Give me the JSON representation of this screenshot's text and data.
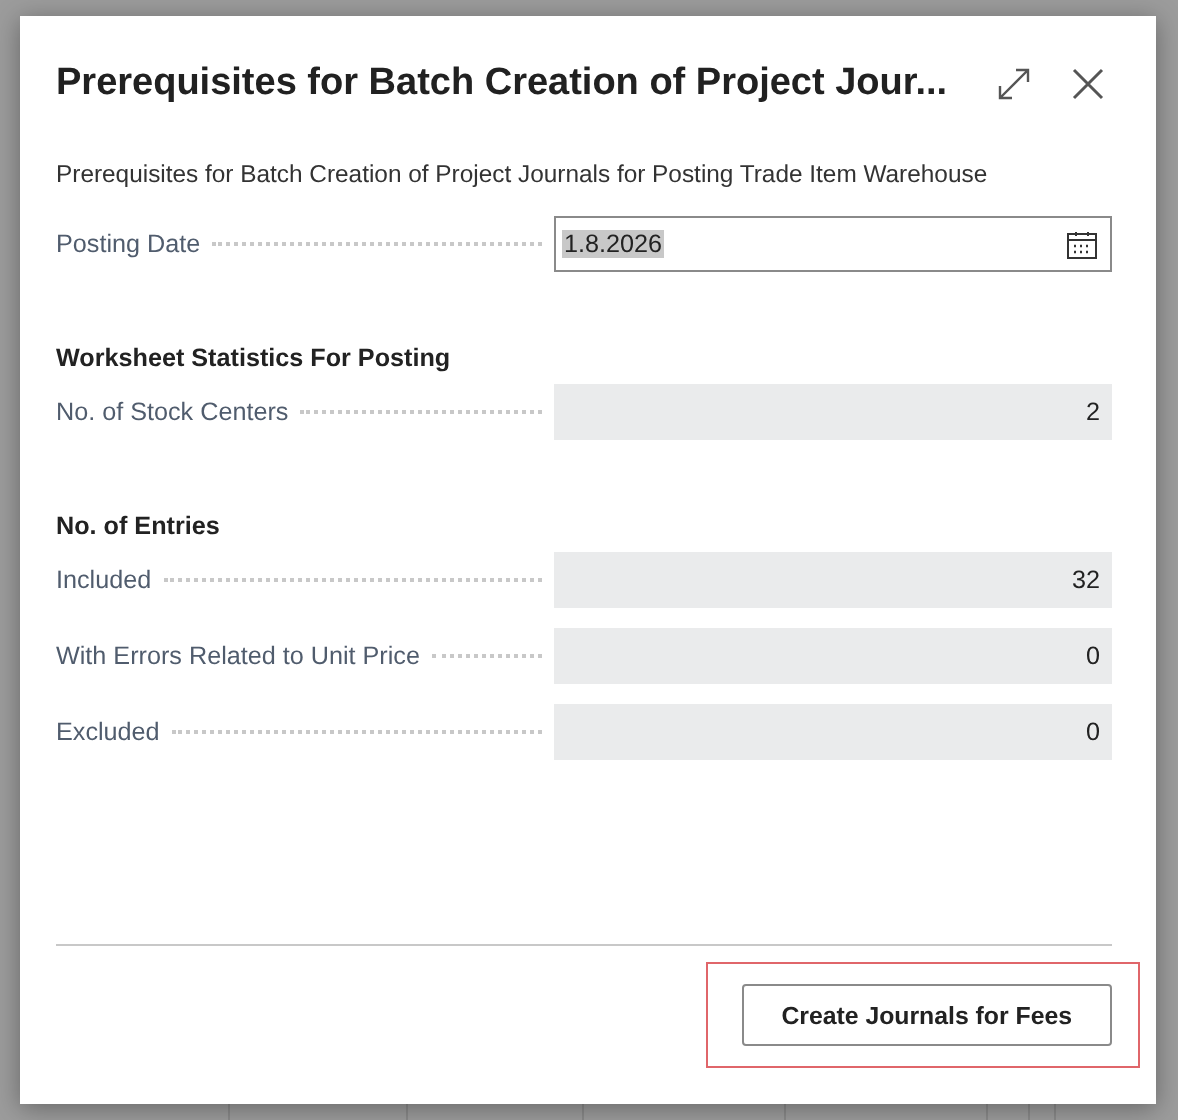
{
  "dialog": {
    "title": "Prerequisites for Batch Creation of Project Jour...",
    "description": "Prerequisites for Batch Creation of Project Journals for Posting Trade Item Warehouse",
    "posting_date": {
      "label": "Posting Date",
      "value": "1.8.2026"
    },
    "sections": [
      {
        "heading": "Worksheet Statistics For Posting",
        "fields": [
          {
            "label": "No. of Stock Centers",
            "value": "2"
          }
        ]
      },
      {
        "heading": "No. of Entries",
        "fields": [
          {
            "label": "Included",
            "value": "32"
          },
          {
            "label": "With Errors Related to Unit Price",
            "value": "0"
          },
          {
            "label": "Excluded",
            "value": "0"
          }
        ]
      }
    ],
    "action": {
      "label": "Create Journals for Fees",
      "highlighted": true
    }
  }
}
